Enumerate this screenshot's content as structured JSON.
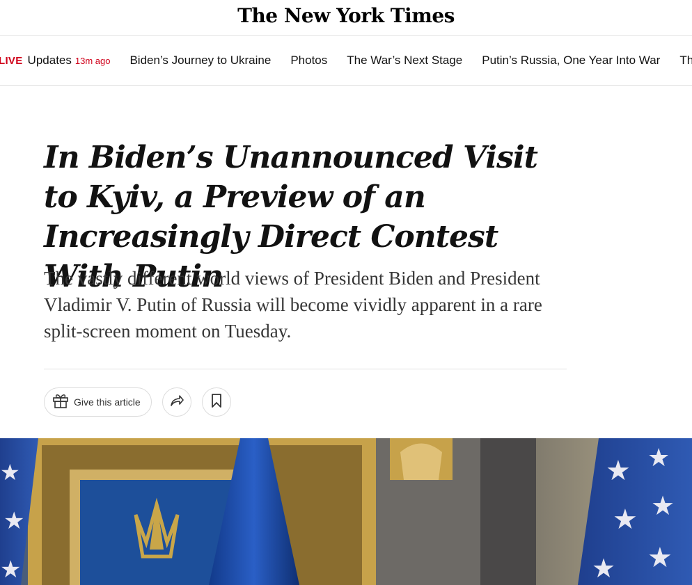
{
  "masthead": {
    "logo": "The New York Times"
  },
  "nav": {
    "live_label": "LIVE",
    "updates_label": "Updates",
    "time_ago": "13m ago",
    "items": [
      "Biden’s Journey to Ukraine",
      "Photos",
      "The War’s Next Stage",
      "Putin’s Russia, One Year Into War",
      "The Roots of the War"
    ]
  },
  "article": {
    "headline": "In Biden’s Unannounced Visit to Kyiv, a Preview of an Increasingly Direct Contest With Putin",
    "summary": "The vastly different world views of President Biden and President Vladimir V. Putin of Russia will become vividly apparent in a rare split-screen moment on Tuesday."
  },
  "actions": {
    "gift_label": "Give this article",
    "gift_icon": "gift-icon",
    "share_icon": "share-icon",
    "save_icon": "bookmark-icon"
  },
  "colors": {
    "live_red": "#d0021b",
    "text": "#121212",
    "summary_text": "#363636"
  }
}
